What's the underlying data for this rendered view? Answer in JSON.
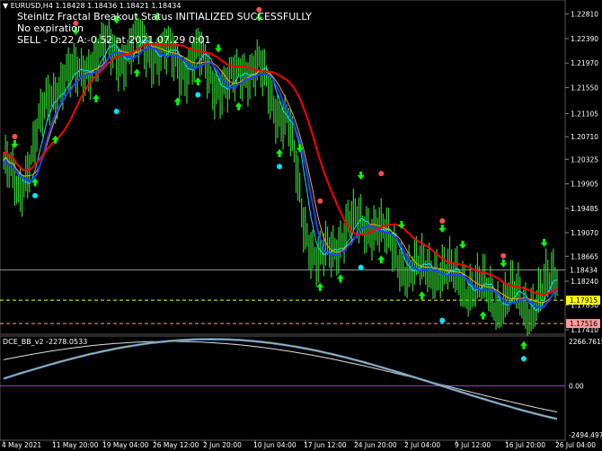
{
  "main": {
    "header": "EURUSD,H4  1.18428 1.18436 1.18421 1.18434",
    "overlay_lines": [
      "Steinitz Fractal Breakout Status INITIALIZED SUCCESSFULLY",
      "No expiration",
      "SELL - D:22 A:-0.52 at 2021.07.29 0:01"
    ],
    "price_ticks": [
      "1.22810",
      "1.22390",
      "1.21970",
      "1.21550",
      "1.21105",
      "1.20710",
      "1.20325",
      "1.19905",
      "1.19485",
      "1.19070",
      "1.18665",
      "1.18240",
      "1.17830",
      "1.17410"
    ],
    "price_labels": {
      "bid": "1.18434",
      "entry": "1.17915",
      "stop": "1.17516"
    },
    "colors": {
      "bid_line": "#9a9a9a",
      "entry": "#ffff00",
      "stop": "#ff9999",
      "up_arrow": "#00ff00",
      "down_arrow": "#ff0000",
      "candle": "#2fcf2f",
      "ma_red": "#ff0000",
      "ma_blue": "#1f3fff",
      "ma_cyan": "#00e5ff",
      "ma_orange": "#ffa500",
      "fractal_top": "#ff4d4d",
      "fractal_bottom": "#00e5ff"
    }
  },
  "indicator": {
    "label": "DCE_BB_v2 -2278.0533",
    "ticks": {
      "top": "2266.7615",
      "zero": "0.00",
      "bottom": "-2494.4975"
    },
    "colors": {
      "zero_line": "#8f3fbf",
      "line_main": "#4a8ad8",
      "line_sig": "#e0e0e0"
    }
  },
  "time_axis": [
    "4 May 2021",
    "11 May 20:00",
    "19 May 04:00",
    "26 May 12:00",
    "2 Jun 20:00",
    "10 Jun 04:00",
    "17 Jun 12:00",
    "24 Jun 20:00",
    "2 Jul 04:00",
    "9 Jul 12:00",
    "16 Jul 20:00",
    "26 Jul 04:00"
  ],
  "chart_data": {
    "type": "candlestick",
    "symbol": "EURUSD",
    "timeframe": "H4",
    "ylim": [
      1.1741,
      1.2288
    ],
    "series_close_approx": [
      1.203,
      1.197,
      1.206,
      1.213,
      1.218,
      1.217,
      1.221,
      1.222,
      1.221,
      1.223,
      1.222,
      1.221,
      1.219,
      1.221,
      1.217,
      1.215,
      1.219,
      1.219,
      1.213,
      1.21,
      1.193,
      1.186,
      1.187,
      1.193,
      1.191,
      1.193,
      1.187,
      1.185,
      1.184,
      1.185,
      1.183,
      1.182,
      1.181,
      1.179,
      1.18,
      1.178,
      1.18,
      1.184
    ],
    "indicator_ylim": [
      -2494.4975,
      2266.7615
    ]
  }
}
